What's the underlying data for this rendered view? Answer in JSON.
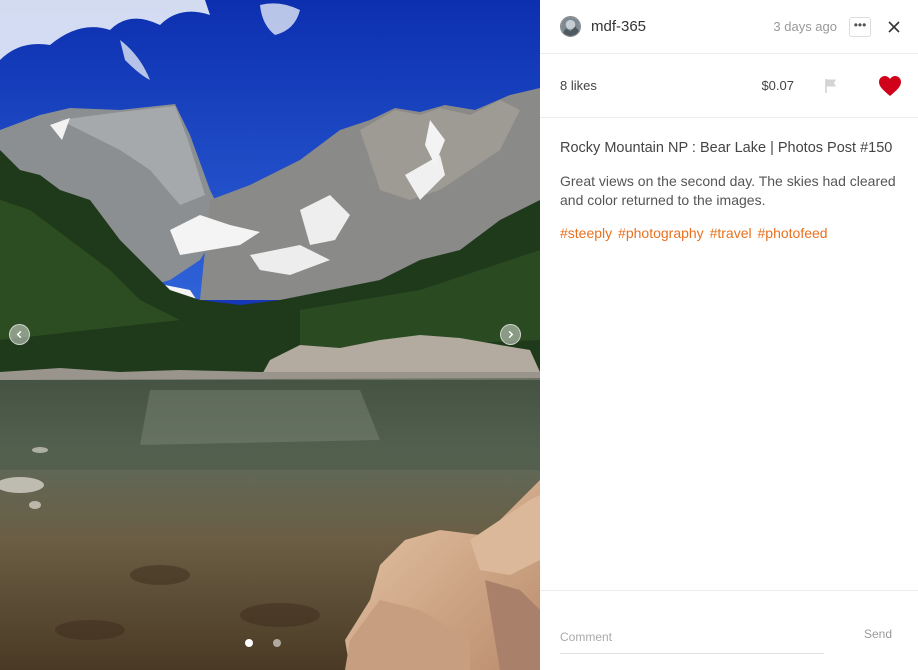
{
  "post": {
    "username": "mdf-365",
    "timestamp": "3 days ago",
    "more_label": "•••",
    "likes": "8 likes",
    "payout": "$0.07",
    "liked": true,
    "title": "Rocky Mountain NP : Bear Lake | Photos Post #150",
    "body": "Great views on the second day. The skies had cleared and color returned to the images.",
    "tags": [
      "#steeply",
      "#photography",
      "#travel",
      "#photofeed"
    ]
  },
  "carousel": {
    "slide_count": 2,
    "active_index": 0
  },
  "comment": {
    "placeholder": "Comment",
    "send_label": "Send"
  },
  "colors": {
    "accent": "#e8711f",
    "heart": "#d0021b"
  },
  "icons": [
    "avatar",
    "more-icon",
    "close-icon",
    "flag-icon",
    "heart-icon",
    "chevron-left-icon",
    "chevron-right-icon"
  ]
}
